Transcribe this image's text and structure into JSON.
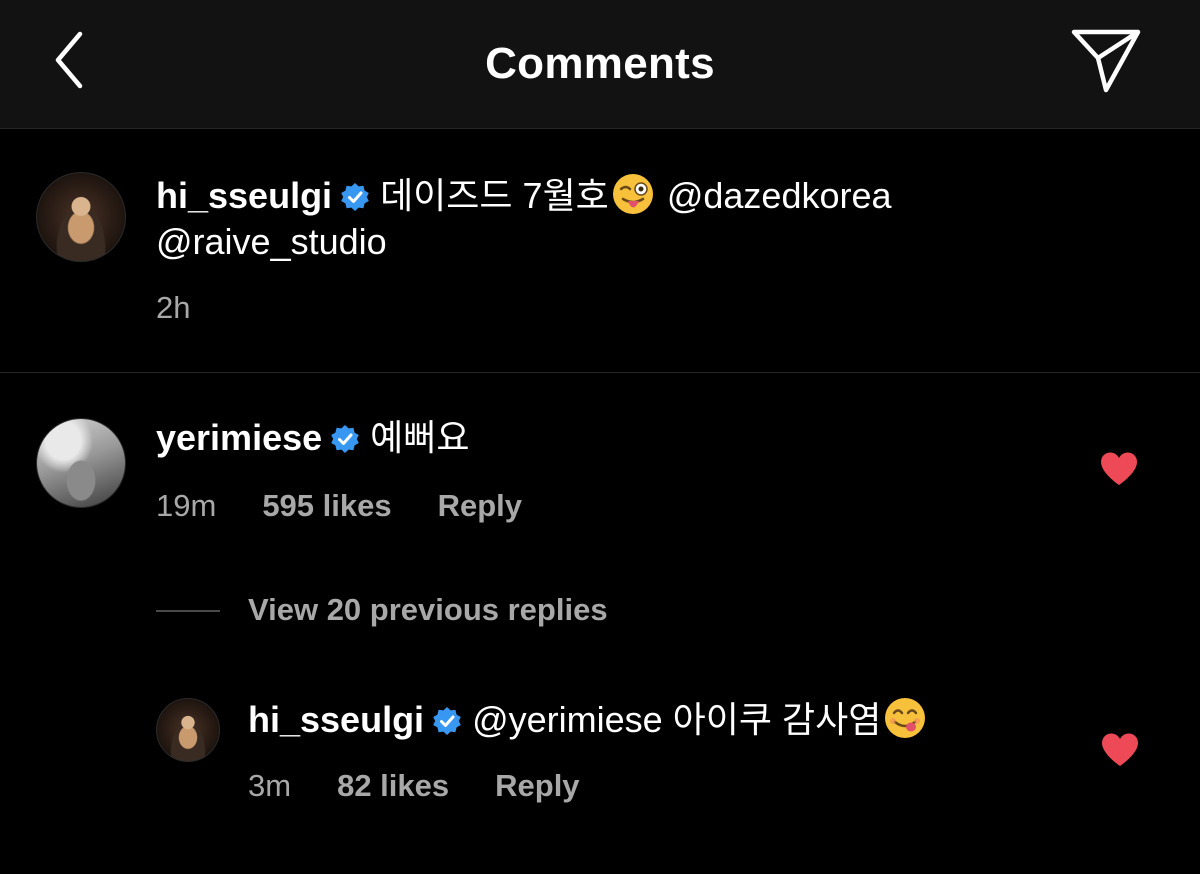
{
  "header": {
    "title": "Comments",
    "back_icon": "chevron-left-icon",
    "share_icon": "paper-plane-icon"
  },
  "caption": {
    "username": "hi_sseulgi",
    "verified": true,
    "text": "데이즈드 7월호",
    "emoji": "😜",
    "mention_1": "@dazedkorea",
    "mention_2": "@raive_studio",
    "time": "2h"
  },
  "comment": {
    "username": "yerimiese",
    "verified": true,
    "text": "예뻐요",
    "time": "19m",
    "likes": "595 likes",
    "reply_label": "Reply",
    "liked": true
  },
  "view_replies_label": "View 20 previous replies",
  "reply": {
    "username": "hi_sseulgi",
    "verified": true,
    "text": "@yerimiese 아이쿠 감사염",
    "emoji": "😋",
    "time": "3m",
    "likes": "82 likes",
    "reply_label": "Reply",
    "liked": true
  },
  "colors": {
    "background": "#000000",
    "header_background": "#121212",
    "text": "#ffffff",
    "secondary_text": "#a8a8a8",
    "verified_blue": "#3897f0",
    "heart_red": "#ed4956"
  }
}
